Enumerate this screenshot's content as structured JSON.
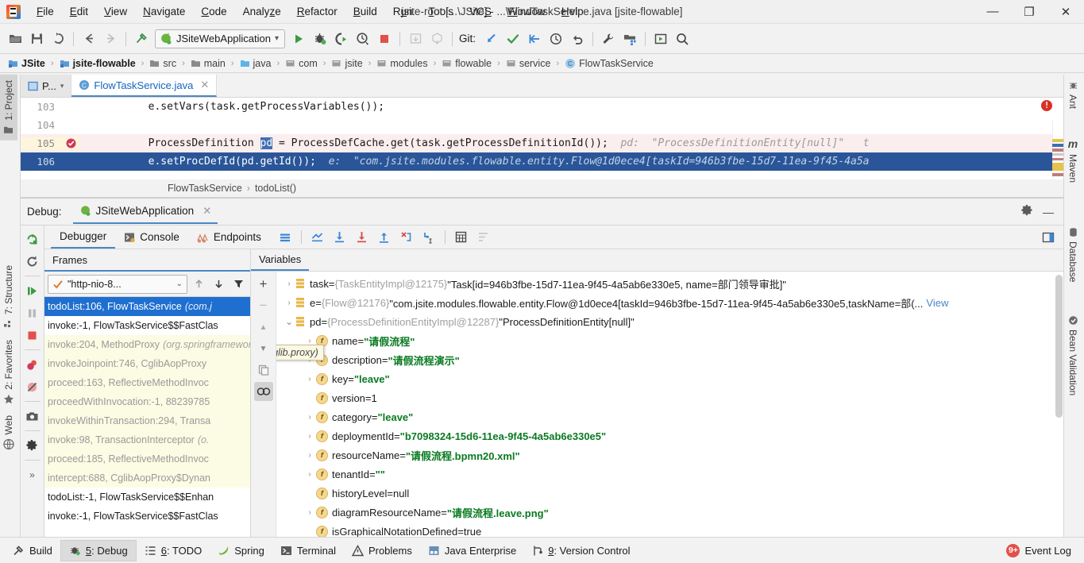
{
  "window": {
    "title": "jsite-root [...\\JSite] - ...\\FlowTaskService.java [jsite-flowable]",
    "minimize": "—",
    "maximize": "❐",
    "close": "✕"
  },
  "menu": [
    {
      "label": "File"
    },
    {
      "label": "Edit"
    },
    {
      "label": "View"
    },
    {
      "label": "Navigate"
    },
    {
      "label": "Code"
    },
    {
      "label": "Analyze"
    },
    {
      "label": "Refactor"
    },
    {
      "label": "Build"
    },
    {
      "label": "Run"
    },
    {
      "label": "Tools"
    },
    {
      "label": "VCS"
    },
    {
      "label": "Window"
    },
    {
      "label": "Help"
    }
  ],
  "toolbar": {
    "run_config": "JSiteWebApplication",
    "git_label": "Git:",
    "icons": [
      "open-project-icon",
      "save-all-icon",
      "sync-icon",
      "back-icon",
      "forward-icon",
      "build-icon",
      "run-icon",
      "debug-icon",
      "run-with-coverage-icon",
      "profile-icon",
      "stop-icon",
      "update-project-icon",
      "push-commit-icon",
      "git-update-icon",
      "git-commit-icon",
      "git-push-icon",
      "git-history-icon",
      "git-revert-icon",
      "settings-wrench-icon",
      "project-structure-icon",
      "run-anything-icon",
      "search-everywhere-icon"
    ]
  },
  "breadcrumb": [
    {
      "label": "JSite",
      "icon": "module-icon",
      "bold": true
    },
    {
      "label": "jsite-flowable",
      "icon": "module-icon",
      "bold": true
    },
    {
      "label": "src",
      "icon": "folder-icon",
      "bold": false
    },
    {
      "label": "main",
      "icon": "folder-icon",
      "bold": false
    },
    {
      "label": "java",
      "icon": "source-folder-icon",
      "bold": false
    },
    {
      "label": "com",
      "icon": "package-icon",
      "bold": false
    },
    {
      "label": "jsite",
      "icon": "package-icon",
      "bold": false
    },
    {
      "label": "modules",
      "icon": "package-icon",
      "bold": false
    },
    {
      "label": "flowable",
      "icon": "package-icon",
      "bold": false
    },
    {
      "label": "service",
      "icon": "package-icon",
      "bold": false
    },
    {
      "label": "FlowTaskService",
      "icon": "class-icon",
      "bold": false
    }
  ],
  "left_rail": [
    {
      "label": "1: Project",
      "icon": "project-folder-icon",
      "active": true
    },
    {
      "label": "7: Structure",
      "icon": "structure-icon",
      "active": false
    },
    {
      "label": "2: Favorites",
      "icon": "star-icon",
      "active": false
    },
    {
      "label": "Web",
      "icon": "globe-icon",
      "active": false
    }
  ],
  "right_rail": [
    {
      "label": "Ant",
      "icon": "ant-icon"
    },
    {
      "label": "Maven",
      "icon": "maven-icon"
    },
    {
      "label": "Database",
      "icon": "database-icon"
    },
    {
      "label": "Bean Validation",
      "icon": "bean-validation-icon"
    }
  ],
  "editor": {
    "tabs": [
      {
        "label": "P...",
        "icon": "project-tab-icon",
        "active": false
      },
      {
        "label": "FlowTaskService.java",
        "icon": "java-class-icon",
        "active": true,
        "close": "✕"
      }
    ],
    "lines": [
      {
        "num": "103",
        "code": "        e.setVars(task.getProcessVariables());",
        "state": "normal"
      },
      {
        "num": "104",
        "code": "",
        "state": "normal"
      },
      {
        "num": "105",
        "code": "        ProcessDefinition pd = ProcessDefCache.get(task.getProcessDefinitionId());",
        "hint": "pd:  \"ProcessDefinitionEntity[null]\"   t",
        "state": "breakpoint",
        "marker": "breakpoint-verified-icon",
        "pre": "        ProcessDefinition ",
        "sel": "pd",
        "post": " = ProcessDefCache.get(task.getProcessDefinitionId());"
      },
      {
        "num": "106",
        "code": "        e.setProcDefId(pd.getId());",
        "state": "current",
        "hint": "e:  \"com.jsite.modules.flowable.entity.Flow@1d0ece4[taskId=946b3fbe-15d7-11ea-9f45-4a5a"
      }
    ],
    "error_marker": "!",
    "bottom_breadcrumb": {
      "class": "FlowTaskService",
      "method": "todoList()",
      "sep": "›"
    }
  },
  "debug": {
    "header_label": "Debug:",
    "session_tab": "JSiteWebApplication",
    "session_close": "✕",
    "gear": "settings-icon",
    "minimize": "—",
    "side_toolbar": [
      "rerun-icon",
      "restart-frame-icon",
      "resume-program-icon",
      "pause-program-icon",
      "stop-icon",
      "view-breakpoints-icon",
      "mute-breakpoints-icon",
      "screenshot-icon",
      "settings-gear-icon",
      "more-icon"
    ],
    "tabs": [
      {
        "label": "Debugger",
        "icon": "",
        "active": true
      },
      {
        "label": "Console",
        "icon": "console-icon",
        "active": false
      },
      {
        "label": "Endpoints",
        "icon": "endpoints-icon",
        "active": false
      }
    ],
    "actions": [
      "layout-icon",
      "show-execution-point-icon",
      "step-over-icon",
      "step-into-icon",
      "force-step-into-icon",
      "step-out-icon",
      "drop-frame-icon",
      "run-to-cursor-icon",
      "evaluate-expression-icon",
      "sort-icon"
    ],
    "restore_layout_icon": "restore-layout-icon",
    "frames": {
      "title": "Frames",
      "thread": "\"http-nio-8...",
      "thread_state_icon": "thread-running-icon",
      "dropdown": "⌄",
      "up_icon": "frame-up-icon",
      "down_icon": "frame-down-icon",
      "filter_icon": "filter-icon",
      "items": [
        {
          "text": "todoList:106, FlowTaskService",
          "pkg": "(com.j",
          "kind": "selected"
        },
        {
          "text": "invoke:-1, FlowTaskService$$FastClas",
          "pkg": "",
          "kind": "own"
        },
        {
          "text": "invoke:204, MethodProxy",
          "pkg": "(org.springframework.cglib.proxy)",
          "kind": "lib"
        },
        {
          "text": "invokeJoinpoint:746, CglibAopProxy",
          "pkg": "",
          "kind": "lib"
        },
        {
          "text": "proceed:163, ReflectiveMethodInvoc",
          "pkg": "",
          "kind": "lib"
        },
        {
          "text": "proceedWithInvocation:-1, 88239785",
          "pkg": "",
          "kind": "lib"
        },
        {
          "text": "invokeWithinTransaction:294, Transa",
          "pkg": "",
          "kind": "lib"
        },
        {
          "text": "invoke:98, TransactionInterceptor",
          "pkg": "(o.",
          "kind": "lib"
        },
        {
          "text": "proceed:185, ReflectiveMethodInvoc",
          "pkg": "",
          "kind": "lib"
        },
        {
          "text": "intercept:688, CglibAopProxy$Dynan",
          "pkg": "",
          "kind": "lib"
        },
        {
          "text": "todoList:-1, FlowTaskService$$Enhan",
          "pkg": "",
          "kind": "own"
        },
        {
          "text": "invoke:-1, FlowTaskService$$FastClas",
          "pkg": "",
          "kind": "own"
        }
      ]
    },
    "variables": {
      "title": "Variables",
      "toolbar": [
        "add-watch-icon",
        "remove-watch-icon",
        "scroll-up-icon",
        "scroll-down-icon",
        "copy-icon",
        "mute-renderers-icon"
      ],
      "rows": [
        {
          "indent": 0,
          "expander": "›",
          "icon": "object-icon",
          "name": "task",
          "eq": " = ",
          "type": "{TaskEntityImpl@12175}",
          "value": "\"Task[id=946b3fbe-15d7-11ea-9f45-4a5ab6e330e5, name=部门领导审批]\"",
          "value_kind": "string-plain"
        },
        {
          "indent": 0,
          "expander": "›",
          "icon": "object-icon",
          "name": "e",
          "eq": " = ",
          "type": "{Flow@12176}",
          "value": "\"com.jsite.modules.flowable.entity.Flow@1d0ece4[taskId=946b3fbe-15d7-11ea-9f45-4a5ab6e330e5,taskName=部(...",
          "value_kind": "string-plain",
          "link": "View"
        },
        {
          "indent": 0,
          "expander": "⌄",
          "icon": "object-icon",
          "name": "pd",
          "eq": " = ",
          "type": "{ProcessDefinitionEntityImpl@12287}",
          "value": "\"ProcessDefinitionEntity[null]\"",
          "value_kind": "string-plain"
        },
        {
          "indent": 1,
          "expander": "›",
          "icon": "field-icon",
          "name": "name",
          "eq": " = ",
          "value": "\"请假流程\"",
          "value_kind": "string"
        },
        {
          "indent": 1,
          "expander": "›",
          "icon": "field-icon",
          "name": "description",
          "eq": " = ",
          "value": "\"请假流程演示\"",
          "value_kind": "string"
        },
        {
          "indent": 1,
          "expander": "›",
          "icon": "field-icon",
          "name": "key",
          "eq": " = ",
          "value": "\"leave\"",
          "value_kind": "string"
        },
        {
          "indent": 1,
          "expander": "",
          "icon": "field-icon",
          "name": "version",
          "eq": " = ",
          "value": "1",
          "value_kind": "number"
        },
        {
          "indent": 1,
          "expander": "›",
          "icon": "field-icon",
          "name": "category",
          "eq": " = ",
          "value": "\"leave\"",
          "value_kind": "string"
        },
        {
          "indent": 1,
          "expander": "›",
          "icon": "field-icon",
          "name": "deploymentId",
          "eq": " = ",
          "value": "\"b7098324-15d6-11ea-9f45-4a5ab6e330e5\"",
          "value_kind": "string"
        },
        {
          "indent": 1,
          "expander": "›",
          "icon": "field-icon",
          "name": "resourceName",
          "eq": " = ",
          "value": "\"请假流程.bpmn20.xml\"",
          "value_kind": "string"
        },
        {
          "indent": 1,
          "expander": "›",
          "icon": "field-icon",
          "name": "tenantId",
          "eq": " = ",
          "value": "\"\"",
          "value_kind": "string"
        },
        {
          "indent": 1,
          "expander": "",
          "icon": "field-icon",
          "name": "historyLevel",
          "eq": " = ",
          "value": "null",
          "value_kind": "null"
        },
        {
          "indent": 1,
          "expander": "›",
          "icon": "field-icon",
          "name": "diagramResourceName",
          "eq": " = ",
          "value": "\"请假流程.leave.png\"",
          "value_kind": "string"
        },
        {
          "indent": 1,
          "expander": "",
          "icon": "field-icon",
          "name": "isGraphicalNotationDefined",
          "eq": " = ",
          "value": "true",
          "value_kind": "number"
        }
      ],
      "tooltip": "work.cglib.proxy)"
    }
  },
  "status_bar": {
    "items": [
      {
        "label": "Build",
        "icon": "build-hammer-icon",
        "active": false
      },
      {
        "label": "5: Debug",
        "icon": "debug-bug-icon",
        "active": true,
        "underline": "5"
      },
      {
        "label": "6: TODO",
        "icon": "todo-list-icon",
        "active": false,
        "underline": "6"
      },
      {
        "label": "Spring",
        "icon": "spring-leaf-icon",
        "active": false
      },
      {
        "label": "Terminal",
        "icon": "terminal-icon",
        "active": false
      },
      {
        "label": "Problems",
        "icon": "problems-warning-icon",
        "active": false
      },
      {
        "label": "Java Enterprise",
        "icon": "java-enterprise-icon",
        "active": false
      },
      {
        "label": "9: Version Control",
        "icon": "version-control-icon",
        "active": false,
        "underline": "9"
      }
    ],
    "event_log": {
      "label": "Event Log",
      "badge": "9+"
    }
  },
  "colors": {
    "accent": "#4a86c5",
    "selection": "#1f6fd0",
    "current_line": "#2a5699",
    "breakpoint_line": "#fbeeee",
    "lib_frame": "#fcfbe4",
    "string_value": "#0a7a22",
    "error": "#d93025"
  }
}
